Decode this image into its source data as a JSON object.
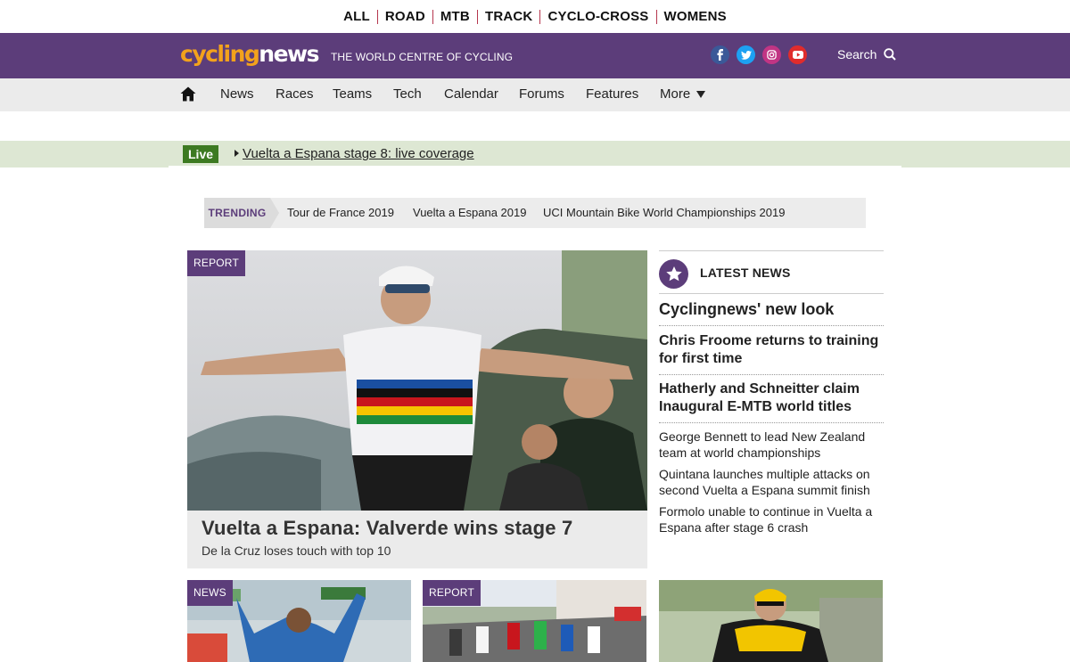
{
  "top_categories": [
    "ALL",
    "ROAD",
    "MTB",
    "TRACK",
    "CYCLO-CROSS",
    "WOMENS"
  ],
  "header": {
    "logo_part1": "cycling",
    "logo_part2": "news",
    "tagline": "THE WORLD CENTRE OF CYCLING",
    "search_label": "Search",
    "social": [
      "facebook-icon",
      "twitter-icon",
      "instagram-icon",
      "youtube-icon"
    ],
    "colors": {
      "brand_purple": "#5c3d7a",
      "logo_orange": "#f3a21c"
    }
  },
  "nav": {
    "items": [
      "News",
      "Races",
      "Teams",
      "Tech",
      "Calendar",
      "Forums",
      "Features",
      "More"
    ]
  },
  "live": {
    "badge": "Live",
    "link": "Vuelta a Espana stage 8: live coverage"
  },
  "trending": {
    "label": "TRENDING",
    "items": [
      "Tour de France 2019",
      "Vuelta a Espana 2019",
      "UCI Mountain Bike World Championships 2019"
    ]
  },
  "hero": {
    "tag": "REPORT",
    "headline": "Vuelta a Espana: Valverde wins stage 7",
    "subheadline": "De la Cruz loses touch with top 10"
  },
  "latest_news": {
    "title": "LATEST NEWS",
    "items": [
      "Cyclingnews' new look",
      "Chris Froome returns to training for first time",
      "Hatherly and Schneitter claim Inaugural E-MTB world titles",
      "George Bennett to lead New Zealand team at world championships",
      "Quintana launches multiple attacks on second Vuelta a Espana summit finish",
      "Formolo unable to continue in Vuelta a Espana after stage 6 crash"
    ]
  },
  "thumbs": [
    {
      "tag": "NEWS"
    },
    {
      "tag": "REPORT"
    },
    {
      "tag": ""
    }
  ]
}
